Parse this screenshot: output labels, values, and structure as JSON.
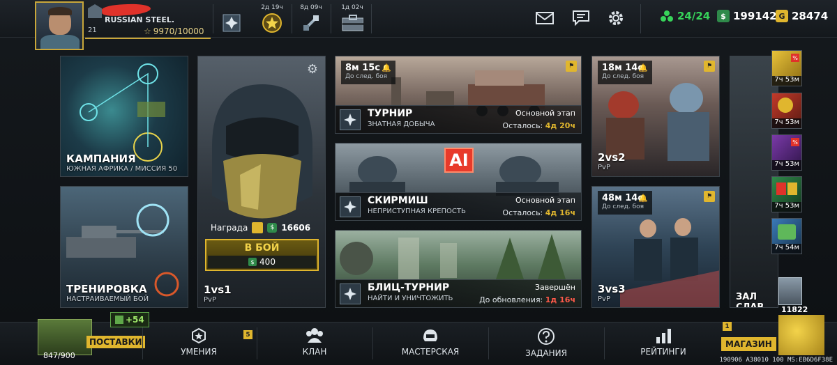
{
  "player": {
    "name": "RUSSIAN STEEL.",
    "level": "21",
    "xp": "9970/10000"
  },
  "top_events": [
    {
      "icon": "clan-cross-icon",
      "time": ""
    },
    {
      "icon": "star-medal-icon",
      "time": "2д 19ч"
    },
    {
      "icon": "satellite-icon",
      "time": "8д 09ч"
    },
    {
      "icon": "supply-case-icon",
      "time": "1д 02ч"
    }
  ],
  "hud": {
    "mail_icon": "mail-icon",
    "chat_icon": "chat-icon",
    "settings_icon": "gear-icon"
  },
  "resources": {
    "energy": "24/24",
    "credits": "199142",
    "gold": "28474"
  },
  "campaign": {
    "title": "КАМПАНИЯ",
    "subtitle": "ЮЖНАЯ АФРИКА / МИССИЯ 50"
  },
  "training": {
    "title": "ТРЕНИРОВКА",
    "subtitle": "НАСТРАИВАЕМЫЙ БОЙ"
  },
  "pvp1": {
    "reward_label": "Награда",
    "reward_value": "16606",
    "battle_button": "В БОЙ",
    "cost": "400",
    "title": "1vs1",
    "subtitle": "PvP"
  },
  "tournament": {
    "timer": "8м 15с",
    "timer_label": "До след. боя",
    "title": "ТУРНИР",
    "subtitle": "ЗНАТНАЯ ДОБЫЧА",
    "stage": "Основной этап",
    "remaining_label": "Осталось:",
    "remaining_value": "4д 20ч"
  },
  "skirmish": {
    "ai_badge": "AI",
    "title": "СКИРМИШ",
    "subtitle": "НЕПРИСТУПНАЯ КРЕПОСТЬ",
    "stage": "Основной этап",
    "remaining_label": "Осталось:",
    "remaining_value": "4д 16ч"
  },
  "blitz": {
    "title": "БЛИЦ-ТУРНИР",
    "subtitle": "НАЙТИ И УНИЧТОЖИТЬ",
    "status": "Завершён",
    "update_label": "До обновления:",
    "update_value": "1д 16ч"
  },
  "pvp2": {
    "timer": "18м 14с",
    "timer_label": "До след. боя",
    "title": "2vs2",
    "subtitle": "PvP"
  },
  "pvp3": {
    "timer": "48м 14с",
    "timer_label": "До след. боя",
    "title": "3vs3",
    "subtitle": "PvP"
  },
  "hall_of_fame": {
    "title": "ЗАЛ СЛАВ"
  },
  "side_offers": [
    {
      "time": "7ч 53м",
      "icon": "gold-offer-icon"
    },
    {
      "time": "7ч 53м",
      "icon": "medal-offer-icon"
    },
    {
      "time": "7ч 53м",
      "icon": "card-offer-icon"
    },
    {
      "time": "7ч 53м",
      "icon": "boosters-offer-icon"
    },
    {
      "time": "7ч 54м",
      "icon": "units-offer-icon"
    }
  ],
  "crate_counter": "11822",
  "supplies": {
    "label": "ПОСТАВКИ",
    "count": "847/900",
    "bonus": "+54"
  },
  "nav": [
    {
      "label": "УМЕНИЯ",
      "badge": "5"
    },
    {
      "label": "КЛАН"
    },
    {
      "label": "МАСТЕРСКАЯ"
    },
    {
      "label": "ЗАДАНИЯ"
    },
    {
      "label": "РЕЙТИНГИ"
    }
  ],
  "shop": {
    "label": "МАГАЗИН",
    "badge": "1"
  },
  "debug_line": "190906 A38010 100 MS:EB6D6F38E",
  "colors": {
    "accent_gold": "#e0b62e",
    "energy_green": "#37d35a",
    "credits_green": "#3aa95a",
    "timer_red": "#ff5a4a"
  }
}
